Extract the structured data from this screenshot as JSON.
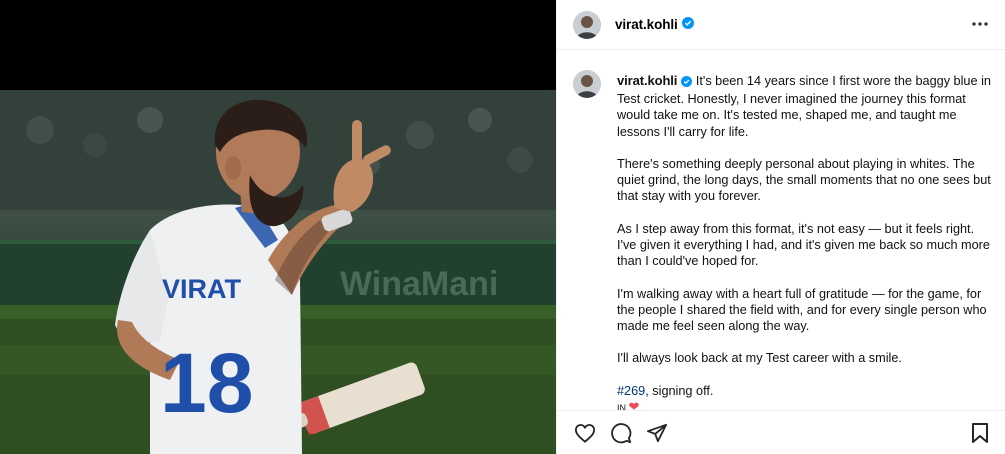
{
  "post": {
    "username": "virat.kohli",
    "verified": true,
    "jersey_name": "VIRAT",
    "jersey_number": "18",
    "caption": {
      "p1": "It's been 14 years since I first wore the baggy blue in Test cricket. Honestly, I never imagined the journey this format would take me on. It's tested me, shaped me, and taught me lessons I'll carry for life.",
      "p2": "There's something deeply personal about playing in whites. The quiet grind, the long days, the small moments that no one sees but that stay with you forever.",
      "p3": "As I step away from this format, it's not easy — but it feels right. I've given it everything I had, and it's given me back so much more than I could've hoped for.",
      "p4": "I'm walking away with a heart full of gratitude — for the game, for the people I shared the field with, and for every single person who made me feel seen along the way.",
      "p5": "I'll always look back at my Test career with a smile.",
      "hashtag": "#269",
      "p6_suffix": ", signing off.",
      "signoff_prefix": "IN",
      "signoff_emoji": "❤"
    }
  },
  "icons": {
    "verified": "verified-badge-icon",
    "more": "more-options-icon",
    "like": "heart-icon",
    "comment": "comment-icon",
    "share": "share-icon",
    "save": "bookmark-icon"
  },
  "colors": {
    "verified_blue": "#0095f6",
    "hashtag_blue": "#00376b",
    "heart_red": "#ed4956",
    "jersey_blue": "#1f4fa8"
  }
}
